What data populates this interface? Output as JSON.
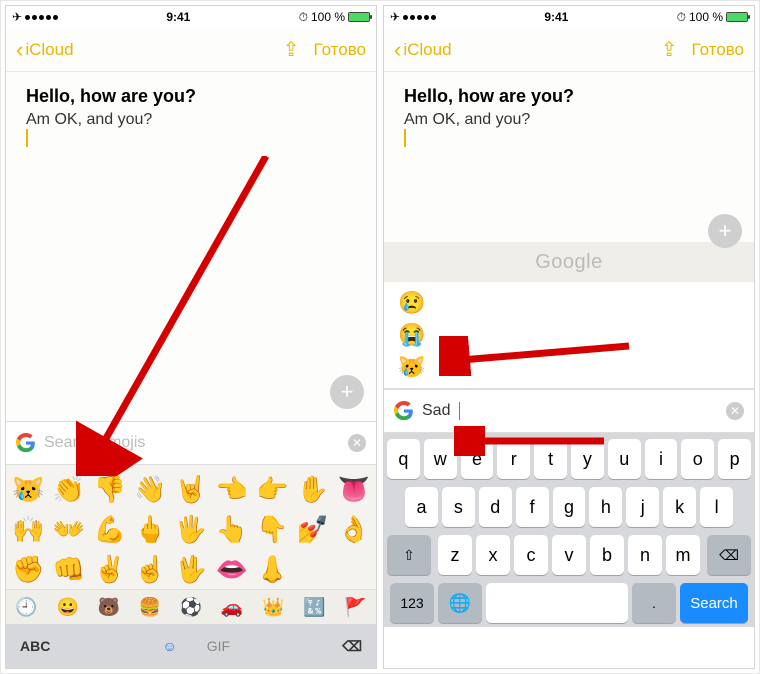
{
  "status": {
    "time": "9:41",
    "battery_pct": "100 %"
  },
  "nav": {
    "back_label": "iCloud",
    "done_label": "Готово"
  },
  "note": {
    "title": "Hello, how are you?",
    "line1": "Am OK, and you?"
  },
  "left": {
    "search_placeholder": "Search emojis",
    "emojis": [
      "😿",
      "👏",
      "👎",
      "👋",
      "🤘",
      "👈",
      "👉",
      "✋",
      "👅",
      "🙌",
      "👐",
      "💪",
      "🖕",
      "🖐",
      "👆",
      "👇",
      "💅",
      "👌",
      "✊",
      "👊",
      "✌️",
      "☝️",
      "🖖",
      "👄",
      "👃"
    ],
    "categories": [
      "🕘",
      "😀",
      "🐻",
      "🍔",
      "⚽",
      "🚗",
      "👑",
      "🔣",
      "🚩"
    ],
    "abc": "ABC",
    "gif": "GIF"
  },
  "right": {
    "google_brand": "Google",
    "suggestions": [
      "😢",
      "😭",
      "😿"
    ],
    "search_value": "Sad",
    "kb_rows": [
      [
        "q",
        "w",
        "e",
        "r",
        "t",
        "y",
        "u",
        "i",
        "o",
        "p"
      ],
      [
        "a",
        "s",
        "d",
        "f",
        "g",
        "h",
        "j",
        "k",
        "l"
      ],
      [
        "z",
        "x",
        "c",
        "v",
        "b",
        "n",
        "m"
      ]
    ],
    "mode_key": "123",
    "search_key": "Search",
    "dot_key": "."
  }
}
